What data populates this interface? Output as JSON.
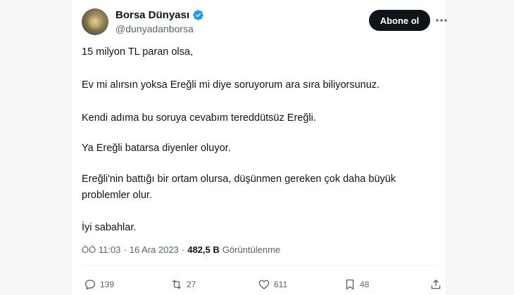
{
  "author": {
    "name": "Borsa Dünyası",
    "handle": "@dunyadanborsa",
    "verified_color": "#1d9bf0"
  },
  "header": {
    "follow_label": "Abone ol",
    "more_icon": "more-horizontal-icon"
  },
  "tweet": {
    "lines": [
      "15 milyon TL paran olsa,",
      "Ev mi alırsın yoksa Ereğli mi diye soruyorum ara sıra biliyorsunuz.",
      "Kendi adıma bu soruya cevabım tereddütsüz Ereğli.",
      "Ya Ereğli batarsa diyenler oluyor.",
      "Ereğli'nin battığı bir ortam olursa, düşünmen gereken çok daha büyük",
      "problemler olur.",
      "İyi sabahlar."
    ]
  },
  "meta": {
    "time": "ÖÖ 11:03",
    "separator": "·",
    "date": "16 Ara 2023",
    "separator2": "·",
    "views_count": "482,5 B",
    "views_label": "Görüntülenme"
  },
  "actions": {
    "replies": "139",
    "retweets": "27",
    "likes": "611",
    "bookmarks": "48"
  },
  "colors": {
    "text_primary": "#0f1419",
    "text_secondary": "#536471",
    "button_bg": "#0f1419"
  }
}
